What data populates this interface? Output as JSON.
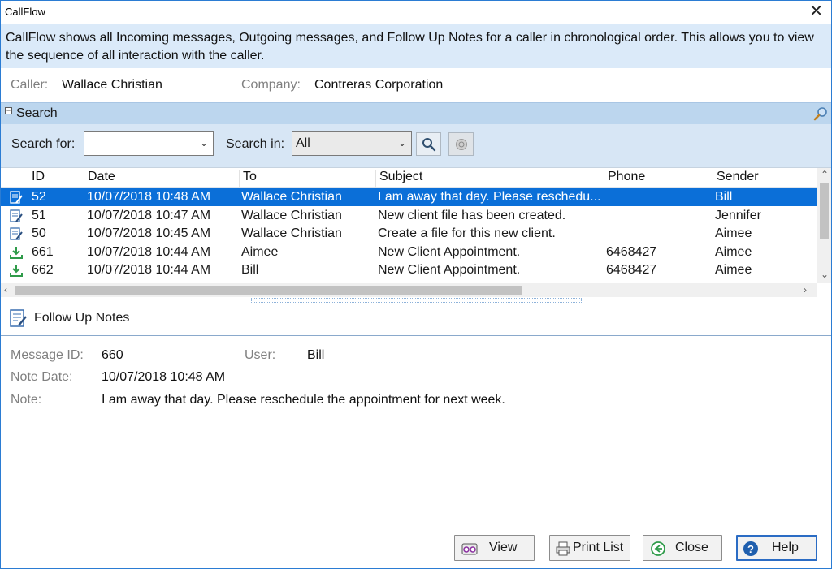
{
  "window": {
    "title": "CallFlow",
    "close_glyph": "✕"
  },
  "info": "CallFlow shows all Incoming messages, Outgoing messages, and Follow Up Notes for a caller in chronological order. This allows you to view the sequence of all interaction with the caller.",
  "caller": {
    "caller_label": "Caller:",
    "caller_value": "Wallace Christian",
    "company_label": "Company:",
    "company_value": "Contreras Corporation"
  },
  "search": {
    "title": "Search",
    "search_for_label": "Search for:",
    "search_for_value": "",
    "search_in_label": "Search in:",
    "search_in_value": "All"
  },
  "grid": {
    "columns": [
      "ID",
      "Date",
      "To",
      "Subject",
      "Phone",
      "Sender"
    ],
    "rows": [
      {
        "icon": "note-icon",
        "id": "52",
        "date": "10/07/2018 10:48 AM",
        "to": "Wallace Christian",
        "subject": "I am away that day. Please reschedu...",
        "phone": "",
        "sender": "Bill",
        "selected": true
      },
      {
        "icon": "note-icon",
        "id": "51",
        "date": "10/07/2018 10:47 AM",
        "to": "Wallace Christian",
        "subject": "New client file has been created.",
        "phone": "",
        "sender": "Jennifer",
        "selected": false
      },
      {
        "icon": "note-icon",
        "id": "50",
        "date": "10/07/2018 10:45 AM",
        "to": "Wallace Christian",
        "subject": "Create a file for this new client.",
        "phone": "",
        "sender": "Aimee",
        "selected": false
      },
      {
        "icon": "incoming-icon",
        "id": "661",
        "date": "10/07/2018 10:44 AM",
        "to": "Aimee",
        "subject": "New Client Appointment.",
        "phone": "6468427",
        "sender": "Aimee",
        "selected": false
      },
      {
        "icon": "incoming-icon",
        "id": "662",
        "date": "10/07/2018 10:44 AM",
        "to": "Bill",
        "subject": "New Client Appointment.",
        "phone": "6468427",
        "sender": "Aimee",
        "selected": false
      }
    ]
  },
  "notes": {
    "title": "Follow Up Notes",
    "message_id_label": "Message ID:",
    "message_id_value": "660",
    "user_label": "User:",
    "user_value": "Bill",
    "note_date_label": "Note Date:",
    "note_date_value": "10/07/2018 10:48 AM",
    "note_label": "Note:",
    "note_value": "I am away that day. Please reschedule the appointment for next week."
  },
  "buttons": {
    "view": "View",
    "print_list": "Print List",
    "close": "Close",
    "help": "Help"
  },
  "colors": {
    "selection": "#0b6fd8",
    "info_band": "#dbeaf9",
    "search_header": "#bcd6ee",
    "search_bar": "#d7e6f5"
  }
}
